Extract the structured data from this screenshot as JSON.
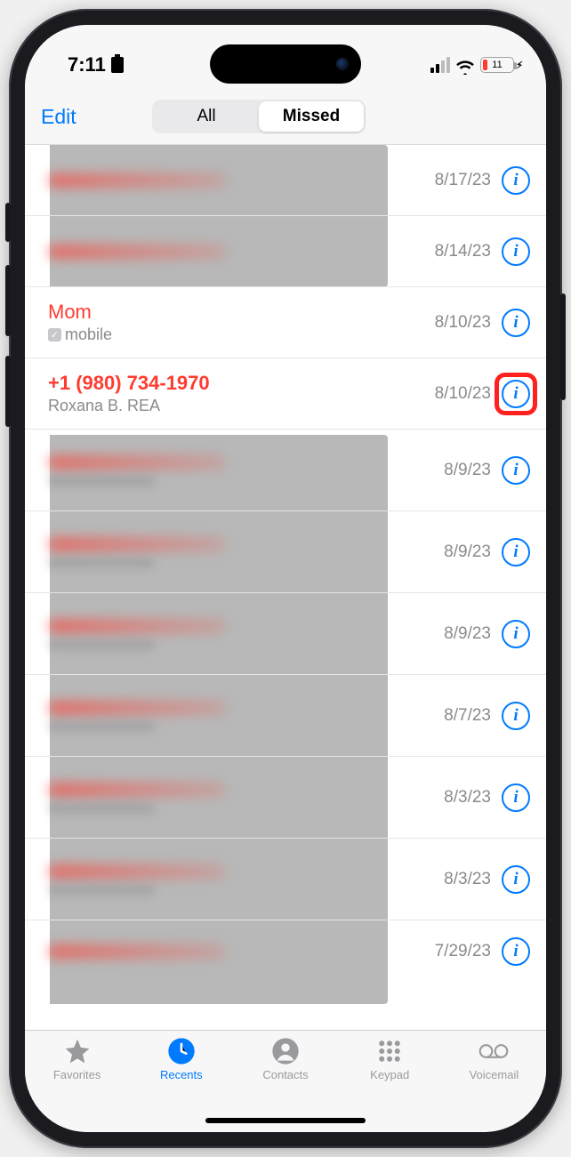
{
  "status": {
    "time": "7:11",
    "battery_pct": "11"
  },
  "nav": {
    "edit": "Edit",
    "seg_all": "All",
    "seg_missed": "Missed"
  },
  "calls": [
    {
      "title": "",
      "sub": "",
      "date": "8/17/23",
      "redacted": true,
      "highlighted": false
    },
    {
      "title": "",
      "sub": "",
      "date": "8/14/23",
      "redacted": true,
      "highlighted": false
    },
    {
      "title": "Mom",
      "sub": "mobile",
      "date": "8/10/23",
      "redacted": false,
      "highlighted": false,
      "has_check": true
    },
    {
      "title": "+1 (980) 734-1970",
      "sub": "Roxana B. REA",
      "date": "8/10/23",
      "redacted": false,
      "highlighted": true
    },
    {
      "title": "",
      "sub": "",
      "date": "8/9/23",
      "redacted": true,
      "highlighted": false
    },
    {
      "title": "",
      "sub": "",
      "date": "8/9/23",
      "redacted": true,
      "highlighted": false
    },
    {
      "title": "",
      "sub": "",
      "date": "8/9/23",
      "redacted": true,
      "highlighted": false
    },
    {
      "title": "",
      "sub": "",
      "date": "8/7/23",
      "redacted": true,
      "highlighted": false
    },
    {
      "title": "",
      "sub": "",
      "date": "8/3/23",
      "redacted": true,
      "highlighted": false
    },
    {
      "title": "",
      "sub": "",
      "date": "8/3/23",
      "redacted": true,
      "highlighted": false
    },
    {
      "title": "",
      "sub": "",
      "date": "7/29/23",
      "redacted": true,
      "highlighted": false
    }
  ],
  "tabs": {
    "favorites": "Favorites",
    "recents": "Recents",
    "contacts": "Contacts",
    "keypad": "Keypad",
    "voicemail": "Voicemail"
  }
}
